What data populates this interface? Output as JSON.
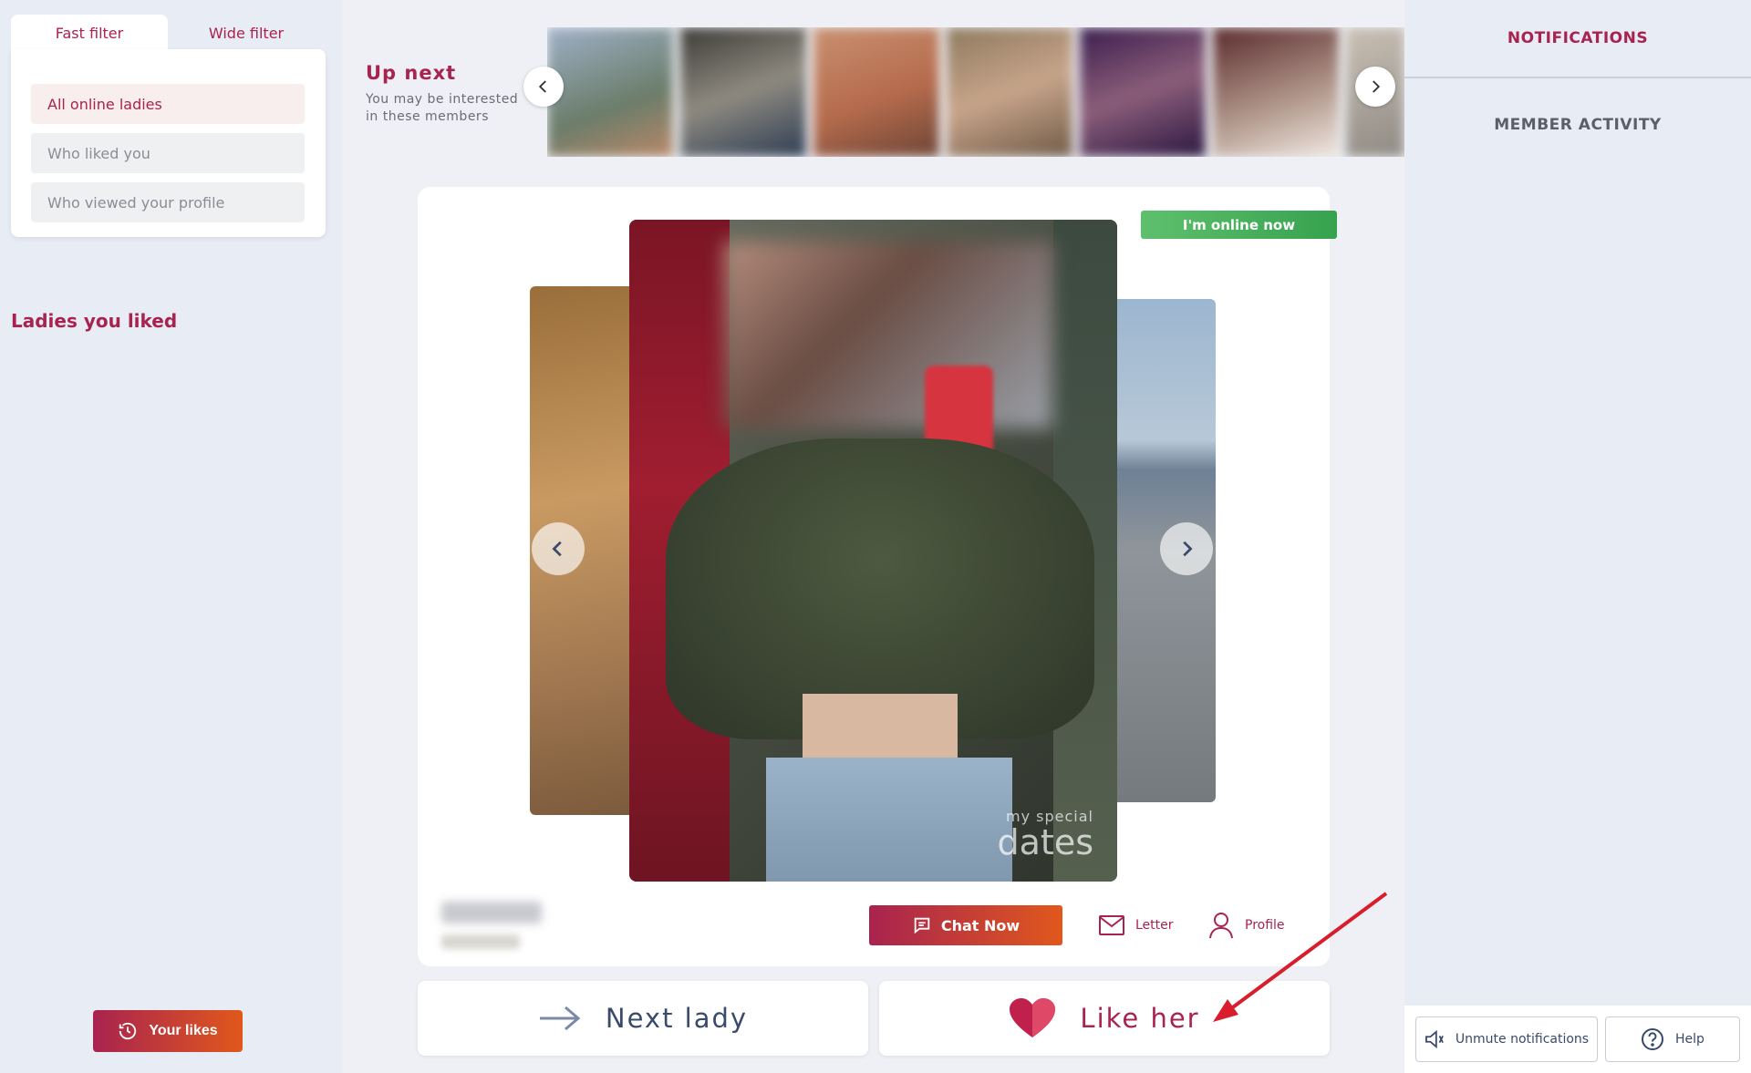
{
  "filter": {
    "tabs": [
      "Fast filter",
      "Wide filter"
    ],
    "items": [
      "All online ladies",
      "Who liked you",
      "Who viewed your profile"
    ]
  },
  "sidebar": {
    "liked_title": "Ladies you liked",
    "your_likes": "Your likes"
  },
  "upnext": {
    "title": "Up next",
    "subtitle": "You may be interested in these members"
  },
  "profile": {
    "online_badge": "I'm online now",
    "watermark_small": "my special",
    "watermark_big": "dates"
  },
  "actions": {
    "chat": "Chat Now",
    "letter": "Letter",
    "profile": "Profile",
    "next": "Next lady",
    "like": "Like her"
  },
  "right": {
    "notifications": "NOTIFICATIONS",
    "activity": "MEMBER ACTIVITY",
    "unmute": "Unmute notifications",
    "help": "Help"
  },
  "icons": [
    "chevron-left-icon",
    "chevron-right-icon",
    "clock-icon",
    "chat-icon",
    "envelope-icon",
    "user-icon",
    "arrow-right-icon",
    "heart-icon",
    "speaker-icon",
    "help-icon"
  ],
  "colors": {
    "brand": "#a8234f",
    "accent": "#e0581c",
    "online": "#36a24e"
  }
}
